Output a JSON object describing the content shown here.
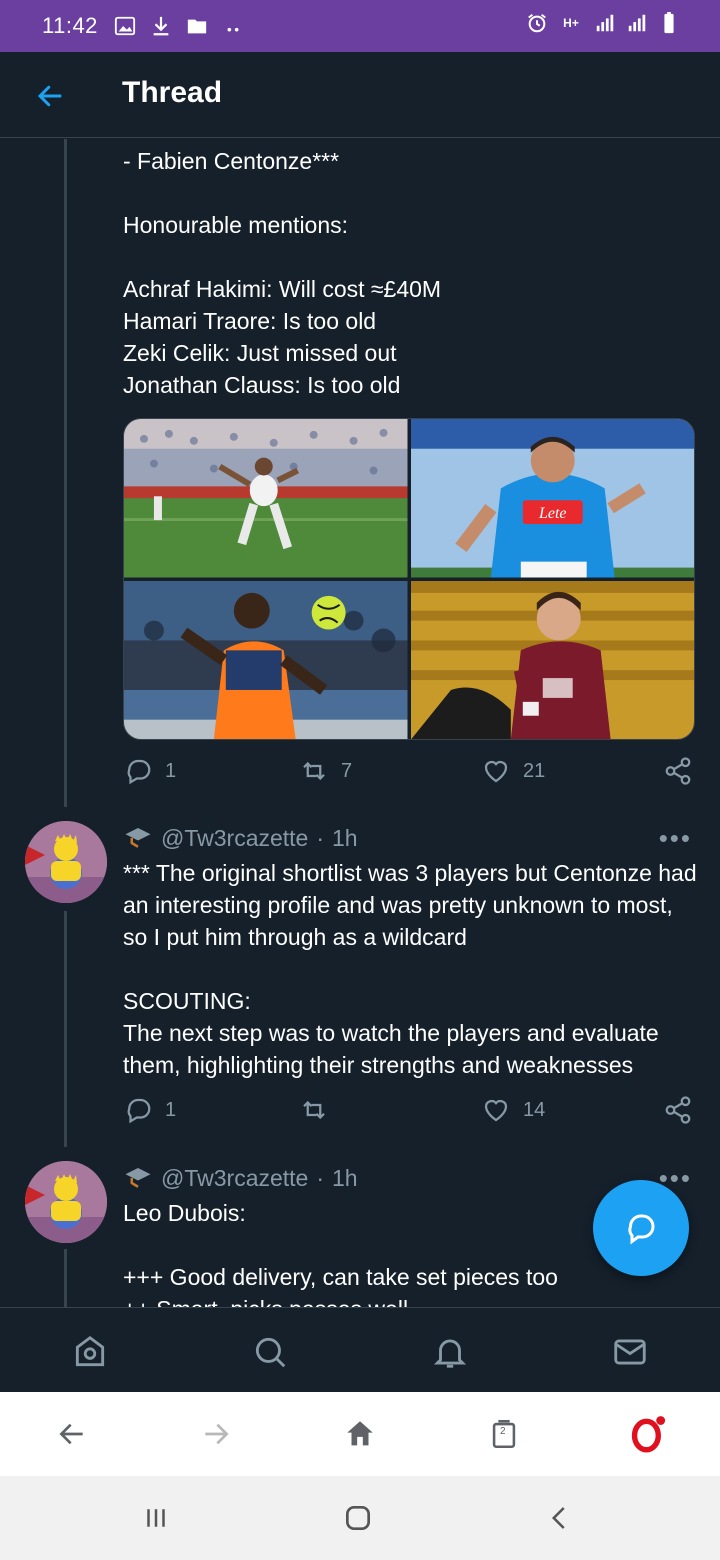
{
  "status_bar": {
    "time": "11:42",
    "network_label": "H+"
  },
  "header": {
    "title": "Thread"
  },
  "tweet_1": {
    "text": "- Fabien Centonze***\n\nHonourable mentions:\n\nAchraf Hakimi: Will cost ≈£40M\nHamari Traore: Is too old\nZeki Celik: Just missed out\nJonathan Clauss: Is too old",
    "replies": "1",
    "retweets": "7",
    "likes": "21"
  },
  "tweet_2": {
    "handle": "@Tw3rcazette",
    "separator": "·",
    "time": "1h",
    "text": "*** The original shortlist was 3 players but Centonze had an interesting profile and was pretty unknown to most, so I put him through as a wildcard\n\nSCOUTING:\nThe next step was to watch the players and evaluate them, highlighting their strengths and weaknesses",
    "replies": "1",
    "retweets": "",
    "likes": "14"
  },
  "tweet_3": {
    "handle": "@Tw3rcazette",
    "separator": "·",
    "time": "1h",
    "text": "Leo Dubois:\n\n+++ Good delivery, can take set pieces too\n++ Smart, picks passes well"
  },
  "more_glyph": "•••",
  "browser": {
    "tab_count": "2"
  },
  "colors": {
    "background": "#15202b",
    "status_bar": "#6a3fa0",
    "accent": "#1da1f2",
    "muted": "#8899a6",
    "divider": "#38444d",
    "opera_red": "#e0101e"
  }
}
